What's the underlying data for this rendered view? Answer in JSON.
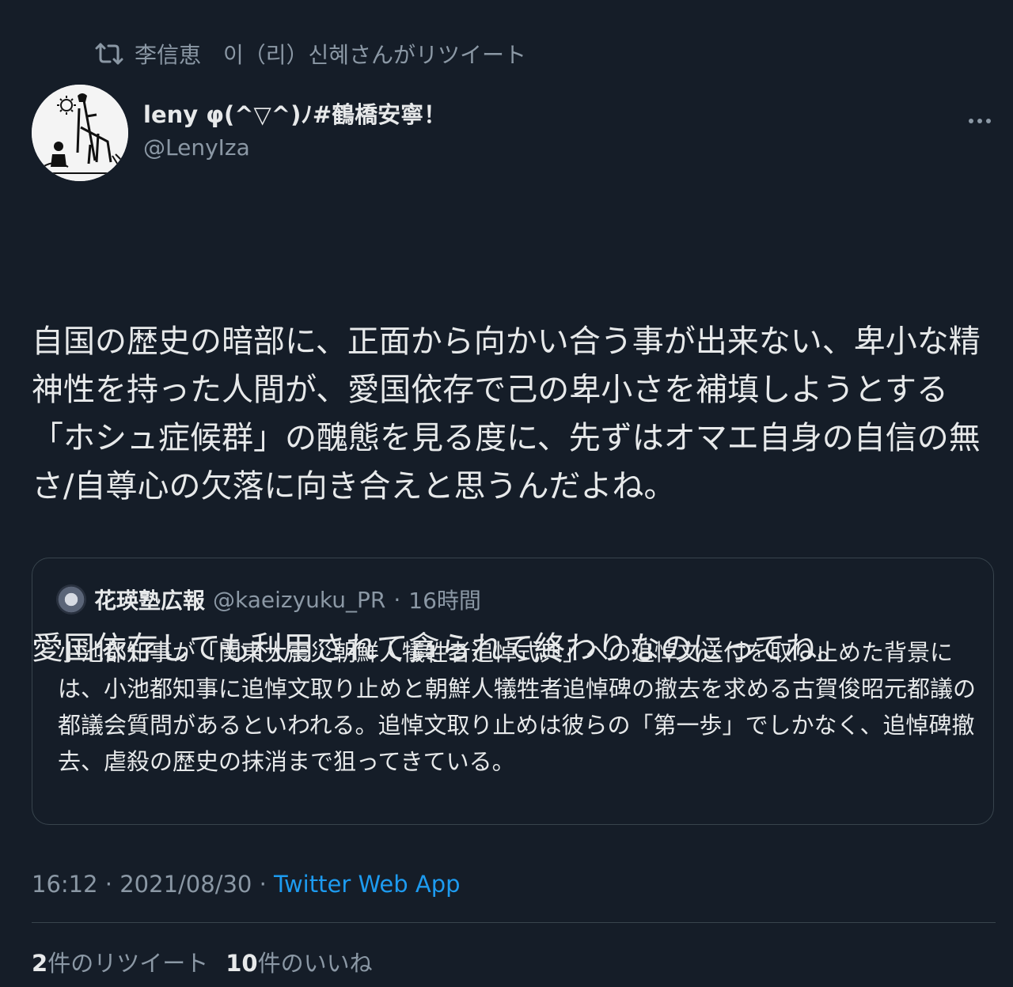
{
  "colors": {
    "background": "#151d28",
    "text_primary": "#e7e9ea",
    "text_secondary": "#8b98a5",
    "link": "#1d9bf0",
    "border": "#38444d"
  },
  "retweet_context": {
    "icon": "retweet-icon",
    "text": "李信恵　이（리）신혜さんがリツイート"
  },
  "author": {
    "display_name": "leny φ(^▽^)ﾉ#鶴橋安寧！",
    "handle": "@LenyIza",
    "avatar_icon": "don-quixote-sketch-avatar"
  },
  "more_icon": "more-options-icon",
  "tweet": {
    "paragraphs": [
      "自国の歴史の暗部に、正面から向かい合う事が出来ない、卑小な精神性を持った人間が、愛国依存で己の卑小さを補填しようとする「ホシュ症候群」の醜態を見る度に、先ずはオマエ自身の自信の無さ/自尊心の欠落に向き合えと思うんだよね。",
      "愛国依存しても利用されて貪られて終わりなのにってね。"
    ]
  },
  "quote": {
    "avatar_icon": "kaeizyuku-logo-icon",
    "name": "花瑛塾広報",
    "handle": "@kaeizyuku_PR",
    "separator": "·",
    "time": "16時間",
    "text": "小池都知事が「関東大震災朝鮮人犠牲者追悼式典」への追悼文送付を取り止めた背景には、小池都知事に追悼文取り止めと朝鮮人犠牲者追悼碑の撤去を求める古賀俊昭元都議の都議会質問があるといわれる。追悼文取り止めは彼らの「第一歩」でしかなく、追悼碑撤去、虐殺の歴史の抹消まで狙ってきている。"
  },
  "meta": {
    "time": "16:12",
    "separator": " · ",
    "date": "2021/08/30",
    "source": "Twitter Web App"
  },
  "stats": {
    "retweets_count": "2",
    "retweets_label": "件のリツイート",
    "likes_count": "10",
    "likes_label": "件のいいね"
  }
}
